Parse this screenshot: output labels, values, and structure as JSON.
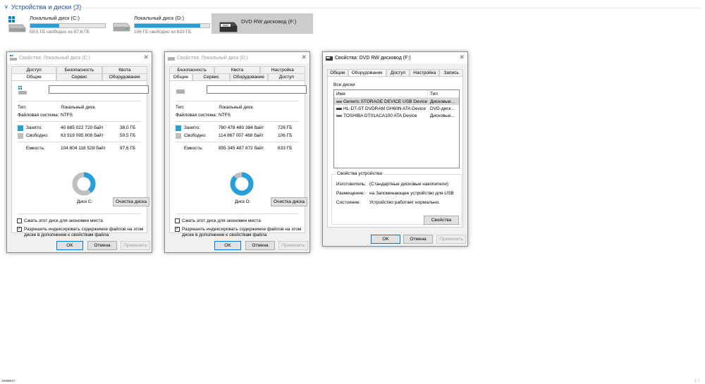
{
  "devices": {
    "header": "Устройства и диски (3)",
    "items": [
      {
        "name": "Локальный диск (C:)",
        "free_text": "59,5 ГБ свободно из 97,6 ГБ",
        "used_fraction": 0.39
      },
      {
        "name": "Локальный диск (D:)",
        "free_text": "106 ГБ свободно из 833 ГБ",
        "used_fraction": 0.873
      },
      {
        "name": "DVD RW дисковод (F:)",
        "icon_label": "DVD"
      }
    ]
  },
  "dialog_c": {
    "title": "Свойства: Локальный диск (C:)",
    "tabs_row1": [
      "Доступ",
      "Безопасность",
      "Квота"
    ],
    "tabs_row2": [
      "Общие",
      "Сервис",
      "Оборудование"
    ],
    "type_label": "Тип:",
    "type_value": "Локальный диск",
    "fs_label": "Файловая система:",
    "fs_value": "NTFS",
    "used_label": "Занято:",
    "used_bytes": "40 885 022 720 байт",
    "used_gb": "38,0 ГБ",
    "free_label": "Свободно:",
    "free_bytes": "63 919 095 808 байт",
    "free_gb": "59,5 ГБ",
    "capacity_label": "Емкость:",
    "capacity_bytes": "104 804 118 528 байт",
    "capacity_gb": "97,6 ГБ",
    "used_fraction": 0.39,
    "disk_label": "Диск C:",
    "cleanup_button": "Очистка диска",
    "compress_label": "Сжать этот диск для экономии места",
    "index_label": "Разрешить индексировать содержимое файлов на этом диске в дополнение к свойствам файла",
    "ok": "OK",
    "cancel": "Отмена",
    "apply": "Применить"
  },
  "dialog_d": {
    "title": "Свойства: Локальный диск (D:)",
    "tabs_row1": [
      "Безопасность",
      "Квота",
      "Настройка"
    ],
    "tabs_row2": [
      "Общие",
      "Сервис",
      "Оборудование",
      "Доступ"
    ],
    "type_label": "Тип:",
    "type_value": "Локальный диск",
    "fs_label": "Файловая система:",
    "fs_value": "NTFS",
    "used_label": "Занято:",
    "used_bytes": "780 478 480 384 байт",
    "used_gb": "726 ГБ",
    "free_label": "Свободно:",
    "free_bytes": "114 867 007 488 байт",
    "free_gb": "106 ГБ",
    "capacity_label": "Емкость:",
    "capacity_bytes": "895 345 487 872 байт",
    "capacity_gb": "833 ГБ",
    "used_fraction": 0.873,
    "disk_label": "Диск D:",
    "cleanup_button": "Очистка диска",
    "compress_label": "Сжать этот диск для экономии места",
    "index_label": "Разрешить индексировать содержимое файлов на этом диске в дополнение к свойствам файла",
    "ok": "OK",
    "cancel": "Отмена",
    "apply": "Применить"
  },
  "dialog_f": {
    "title": "Свойства: DVD RW дисковод (F:)",
    "tabs": [
      "Общие",
      "Оборудование",
      "Доступ",
      "Настройка",
      "Запись"
    ],
    "all_disks_label": "Все диски:",
    "col_name": "Имя",
    "col_type": "Тип",
    "rows": [
      {
        "name": "Generic STORAGE DEVICE USB Device",
        "type": "Дисковые..."
      },
      {
        "name": "HL-DT-ST DVDRAM GH60N ATA Device",
        "type": "DVD-диск..."
      },
      {
        "name": "TOSHIBA DT01ACA100 ATA Device",
        "type": "Дисковые..."
      }
    ],
    "props_title": "Свойства устройства",
    "manufacturer_label": "Изготовитель:",
    "manufacturer_value": "(Стандартные дисковые накопители)",
    "location_label": "Размещение:",
    "location_value": "на Запоминающее устройство для USB",
    "status_label": "Состояние:",
    "status_value": "Устройство работает нормально.",
    "properties_button": "Свойства",
    "ok": "OK",
    "cancel": "Отмена",
    "apply": "Применить"
  },
  "colors": {
    "accent": "#1e4e9c",
    "bar": "#26a0da",
    "used": "#26a0da",
    "free": "#bfbfbf"
  },
  "bottom_left": "элемент",
  "bottom_right": "⋮⋮"
}
